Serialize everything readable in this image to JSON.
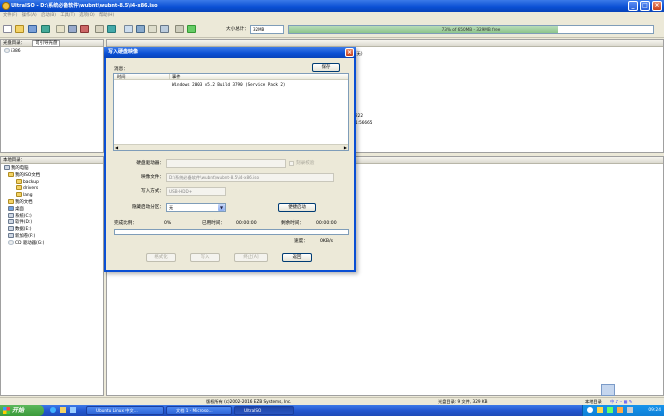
{
  "window": {
    "title": "UltraISO - D:\\系统必备软件\\wubnt\\wubnt-8.5\\i4-x86.iso",
    "menu": [
      "文件(F)",
      "操作(A)",
      "启动(B)",
      "工具(T)",
      "选项(O)",
      "帮助(H)"
    ]
  },
  "toolbar": {
    "size_label": "大小总计：",
    "size_value": "32MB",
    "capacity_text": "73% of 650MB - 329MB free"
  },
  "top_panel": {
    "header_tabs": [
      "光盘目录：",
      "可引导光盘"
    ],
    "tree": [
      "i386"
    ],
    "right_hint": "(无)",
    "right_numbers": [
      "222",
      "1:56665"
    ]
  },
  "local_panel": {
    "header": "本地目录：",
    "tree": [
      "我的电脑",
      "我的ISO文档",
      "backup",
      "drivers",
      "lang",
      "我的文档",
      "桌面",
      "系统(C:)",
      "软件(D:)",
      "数据(E:)",
      "新加卷(F:)",
      "CD 驱动器(G:)"
    ]
  },
  "statusbar": {
    "copyright": "版权所有 (c)2002-2016 EZB Systems, Inc.",
    "disc_info": "光盘目录: 9 文件, 329 KB",
    "local_info": "本地目录"
  },
  "taskbar": {
    "start": "开始",
    "tasks": [
      "Ubuntu Linux 中文…",
      "文档 1 - Microso…",
      "UltraISO"
    ],
    "clock": "09:24"
  },
  "dialog": {
    "title": "写入硬盘映像",
    "save_button": "保存",
    "message_label": "消息：",
    "col_time": "时间",
    "col_event": "事件",
    "log": [
      {
        "time": "",
        "event": "Windows 2003 v5.2 Build 3790 (Service Pack 2)"
      }
    ],
    "disk_drive_label": "硬盘驱动器：",
    "disk_drive_value": "",
    "verify_label": "刻录校验",
    "image_file_label": "映像文件：",
    "image_file_value": "D:\\系统必备软件\\wubnt\\wubnt-8.5\\i4-x86.iso",
    "write_method_label": "写入方式：",
    "write_method_value": "USB-HDD+",
    "hide_boot_label": "隐藏启动分区：",
    "hide_boot_value": "无",
    "boot_button": "便捷启动",
    "complete_label": "完成比例：",
    "complete_value": "0%",
    "elapsed_label": "已用时间：",
    "elapsed_value": "00:00:00",
    "remaining_label": "剩余时间：",
    "remaining_value": "00:00:00",
    "speed_label": "速度：",
    "speed_value": "0KB/s",
    "progress": 0,
    "buttons": {
      "format": "格式化",
      "write": "写入",
      "stop": "终止[A]",
      "back": "返回"
    }
  }
}
